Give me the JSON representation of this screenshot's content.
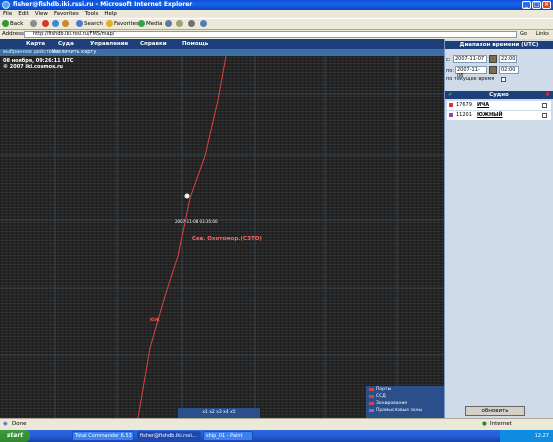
{
  "window": {
    "title": "fisher@fishdb.iki.rssi.ru - Microsoft Internet Explorer",
    "minimize": "_",
    "maximize": "□",
    "close": "×"
  },
  "menubar": [
    "File",
    "Edit",
    "View",
    "Favorites",
    "Tools",
    "Help"
  ],
  "toolbar": {
    "back": "Back",
    "search": "Search",
    "favorites": "Favorites",
    "media": "Media"
  },
  "address": {
    "label": "Address",
    "url": "http://fishdb.iki.rssi.ru/FMS/map/",
    "go": "Go",
    "links": "Links"
  },
  "nav": [
    "Карта",
    "Суда",
    "Управление",
    "Справки",
    "Помощь"
  ],
  "subnav": {
    "action_label": "выбранное действие:",
    "action": "Увеличить карту"
  },
  "map": {
    "timestamp": "08 ноября, 09:26:11 UTC",
    "copyright": "© 2007 iki.cosmos.ru",
    "point_label": "2007-11-08 03:35:00",
    "track_label": "Сев. Охотомор.(СЗТО)",
    "ship_marker_label": "ЮЖ",
    "scale": "x1  x2  x3  x4  x5"
  },
  "legend": {
    "items": [
      {
        "label": "Порты",
        "color": "#e0403c"
      },
      {
        "label": "ССД",
        "color": "#e0403c"
      },
      {
        "label": "Зонирование",
        "color": "#d04060"
      },
      {
        "label": "Промысловые зоны",
        "color": "#8070d0"
      }
    ]
  },
  "panel": {
    "time_range_title": "Диапазон времени (UTC)",
    "from_label": "с:",
    "from_date": "2007-11-07",
    "from_time": "22:00",
    "to_label": "по:",
    "to_date": "2007-11-08",
    "to_time": "02:00",
    "current_time_label": "по текущее время",
    "ships_header": "Судно",
    "ships": [
      {
        "number": "17679",
        "name": "ИЧА",
        "color": "#e23030"
      },
      {
        "number": "11201",
        "name": "ЮЖНЫЙ",
        "color": "#9040c0"
      }
    ],
    "update_button": "обновить"
  },
  "statusbar": {
    "done": "Done",
    "zone": "Internet"
  },
  "taskbar": {
    "start": "start",
    "tasks": [
      "Total Commander 6.53 - ...",
      "fisher@fishdb.iki.rssi...",
      "ship_01 - Paint"
    ],
    "clock": "12:27"
  }
}
